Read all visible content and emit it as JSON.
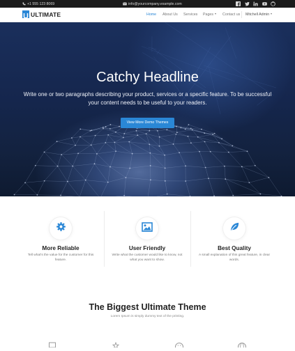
{
  "topbar": {
    "phone": "+1 555 123 8069",
    "email": "info@yourcompany.example.com",
    "social_icons": [
      "facebook-icon",
      "twitter-icon",
      "linkedin-icon",
      "youtube-icon",
      "github-icon"
    ]
  },
  "nav": {
    "brand": "ULTIMATE",
    "items": {
      "home": "Home",
      "about": "About Us",
      "services": "Services",
      "pages": "Pages",
      "contact": "Contact us",
      "user": "Mitchell Admin"
    }
  },
  "hero": {
    "title": "Catchy Headline",
    "text": "Write one or two paragraphs describing your product, services or a specific feature.  To be successful your content needs to be useful to your readers.",
    "button": "View More Demo Themes"
  },
  "features": [
    {
      "icon": "gear-icon",
      "title": "More Reliable",
      "text": "Tell what's the value for the customer for this feature."
    },
    {
      "icon": "image-icon",
      "title": "User Friendly",
      "text": "Write what the customer would like to know, not what you want to show."
    },
    {
      "icon": "leaf-icon",
      "title": "Best Quality",
      "text": "A small explanation of this great feature, in clear words."
    }
  ],
  "section": {
    "title": "The Biggest Ultimate Theme",
    "subtitle": "Lorem Ipsum is simply dummy text of the printing."
  },
  "colors": {
    "accent": "#2a87d6",
    "topbar": "#1b1b1b"
  }
}
